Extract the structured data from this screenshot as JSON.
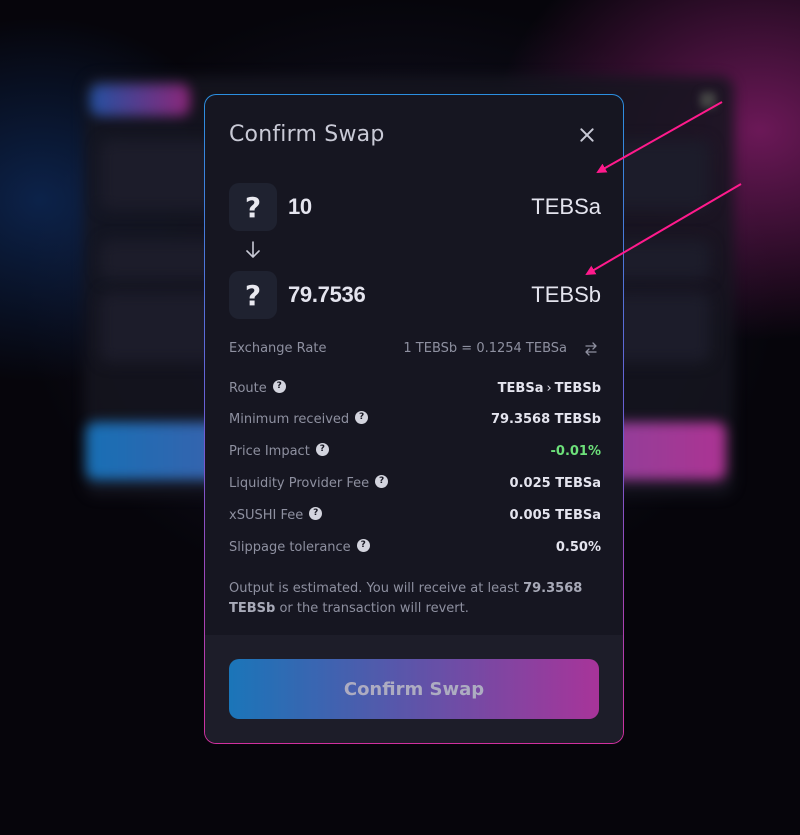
{
  "modal": {
    "title": "Confirm Swap"
  },
  "input_token": {
    "icon": "question-mark-icon",
    "icon_glyph": "?",
    "amount": "10",
    "symbol": "TEBSa"
  },
  "output_token": {
    "icon": "question-mark-icon",
    "icon_glyph": "?",
    "amount": "79.7536",
    "symbol": "TEBSb"
  },
  "exchange_rate": {
    "label": "Exchange Rate",
    "value": "1 TEBSb = 0.1254 TEBSa"
  },
  "details": {
    "route": {
      "label": "Route",
      "from": "TEBSa",
      "separator": "›",
      "to": "TEBSb"
    },
    "minimum_received": {
      "label": "Minimum received",
      "value": "79.3568 TEBSb"
    },
    "price_impact": {
      "label": "Price Impact",
      "value": "-0.01%"
    },
    "liquidity_provider_fee": {
      "label": "Liquidity Provider Fee",
      "value": "0.025 TEBSa"
    },
    "xsushi_fee": {
      "label": "xSUSHI Fee",
      "value": "0.005 TEBSa"
    },
    "slippage_tolerance": {
      "label": "Slippage tolerance",
      "value": "0.50%"
    },
    "help_glyph": "?"
  },
  "note": {
    "prefix": "Output is estimated. You will receive at least ",
    "amount": "79.3568",
    "symbol": "TEBSb",
    "suffix": " or the transaction will revert."
  },
  "confirm_button": {
    "label": "Confirm Swap"
  },
  "colors": {
    "accent_start": "#1a85d2",
    "accent_end": "#c038ad",
    "positive": "#6de07a",
    "annotation_arrow": "#ff1a8c"
  }
}
